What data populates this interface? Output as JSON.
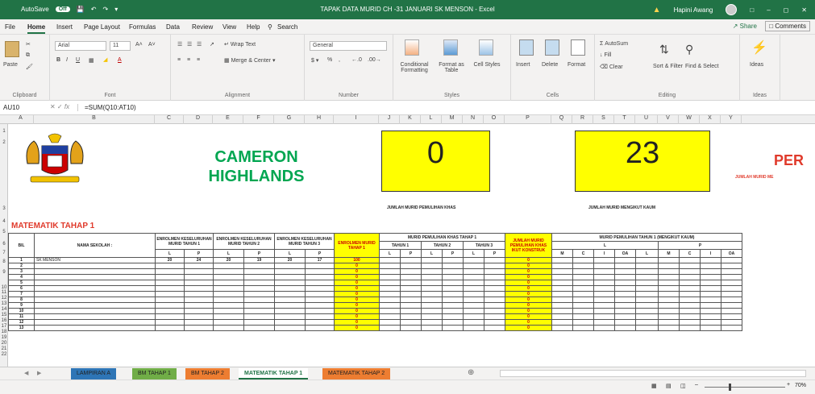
{
  "titlebar": {
    "autosave": "AutoSave",
    "autosave_state": "Off",
    "title": "TAPAK DATA MURID CH -31 JANUARI SK MENSON  -  Excel",
    "user": "Hapini Awang"
  },
  "tabs": [
    "File",
    "Home",
    "Insert",
    "Page Layout",
    "Formulas",
    "Data",
    "Review",
    "View",
    "Help"
  ],
  "search": "Search",
  "share": "Share",
  "comments": "Comments",
  "ribbon": {
    "clipboard": {
      "paste": "Paste",
      "label": "Clipboard"
    },
    "font": {
      "name": "Arial",
      "size": "11",
      "label": "Font"
    },
    "alignment": {
      "wrap": "Wrap Text",
      "merge": "Merge & Center",
      "label": "Alignment"
    },
    "number": {
      "format": "General",
      "label": "Number"
    },
    "styles": {
      "cond": "Conditional Formatting",
      "fmt_table": "Format as Table",
      "cell_styles": "Cell Styles",
      "label": "Styles"
    },
    "cells": {
      "insert": "Insert",
      "delete": "Delete",
      "format": "Format",
      "label": "Cells"
    },
    "editing": {
      "autosum": "AutoSum",
      "fill": "Fill",
      "clear": "Clear",
      "sort": "Sort & Filter",
      "find": "Find & Select",
      "label": "Editing"
    },
    "ideas": {
      "ideas": "Ideas",
      "label": "Ideas"
    }
  },
  "formula_bar": {
    "name_box": "AU10",
    "formula": "=SUM(Q10:AT10)"
  },
  "columns": [
    "A",
    "B",
    "C",
    "D",
    "E",
    "F",
    "G",
    "H",
    "I",
    "J",
    "K",
    "L",
    "M",
    "N",
    "O",
    "P",
    "Q",
    "R",
    "S",
    "T",
    "U",
    "V",
    "W",
    "X",
    "Y"
  ],
  "sheet": {
    "district": "CAMERON HIGHLANDS",
    "box1_value": "0",
    "box1_caption": "JUMLAH MURID PEMULIHAN KHAS",
    "box2_value": "23",
    "box2_caption": "JUMLAH MURID MENGIKUT KAUM",
    "per_text": "PER",
    "per_sub": "JUMLAH MURID ME",
    "section": "MATEMATIK TAHAP 1",
    "h_bil": "BIL",
    "h_nama": "NAMA SEKOLAH :",
    "h_enrol1": "ENROLMEN KESELURUHAN MURID TAHUN 1",
    "h_enrol2": "ENROLMEN KESELURUHAN MURID TAHUN 2",
    "h_enrol3": "ENROLMEN KESELURUHAN MURID TAHUN 3",
    "h_enrol_tahap": "ENROLMEN MURID TAHAP 1",
    "h_pk": "MURID PEMULIHAN KHAS TAHAP 1",
    "h_th1": "TAHUN 1",
    "h_th2": "TAHUN 2",
    "h_th3": "TAHUN 3",
    "h_jumlah": "JUMLAH MURID PEMULIHAN KHAS IKUT KONSTRUK",
    "h_kaum": "MURID PEMULIHAN TAHUN 1 (MENGIKUT KAUM)",
    "L": "L",
    "P": "P",
    "M": "M",
    "C": "C",
    "I": "I",
    "OA": "OA",
    "row1": {
      "bil": "1",
      "nama": "SK MENSON",
      "c": "20",
      "d": "24",
      "e": "20",
      "f": "19",
      "g": "20",
      "h": "17",
      "i": "100",
      "p": "0"
    },
    "zero": "0",
    "bil_numbers": [
      "2",
      "3",
      "4",
      "5",
      "6",
      "7",
      "8",
      "9",
      "10",
      "11",
      "12",
      "13"
    ],
    "row_numbers": [
      "1",
      "2",
      "3",
      "4",
      "5",
      "6",
      "7",
      "8",
      "9",
      "10",
      "11",
      "12",
      "13",
      "14",
      "15",
      "16",
      "17",
      "18",
      "19",
      "20",
      "21",
      "22"
    ]
  },
  "sheet_tabs": [
    {
      "label": "LAMPIRAN A",
      "color": "#2e75b6"
    },
    {
      "label": "BM TAHAP 1",
      "color": "#70ad47"
    },
    {
      "label": "BM TAHAP 2",
      "color": "#ed7d31"
    },
    {
      "label": "MATEMATIK TAHAP 1",
      "color": "#ffffff"
    },
    {
      "label": "MATEMATIK TAHAP 2",
      "color": "#ed7d31"
    }
  ],
  "status": {
    "zoom": "70%"
  }
}
